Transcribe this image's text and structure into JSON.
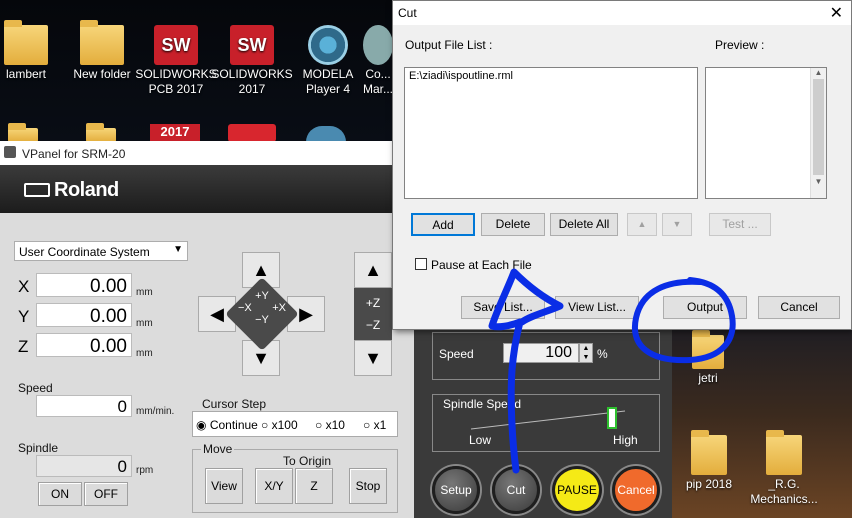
{
  "desktop": {
    "icons": [
      {
        "label": "lambert",
        "kind": "folder"
      },
      {
        "label": "New folder",
        "kind": "folder"
      },
      {
        "label": "SOLIDWORKS PCB 2017",
        "kind": "sw"
      },
      {
        "label": "SOLIDWORKS 2017",
        "kind": "sw2017"
      },
      {
        "label": "MODELA Player 4",
        "kind": "modela"
      },
      {
        "label": "Co... Mar...",
        "kind": "app"
      },
      {
        "label": "jetri",
        "kind": "folder"
      },
      {
        "label": "pip 2018",
        "kind": "folder"
      },
      {
        "label": "_R.G. Mechanics...",
        "kind": "folder"
      }
    ],
    "sw_badge": "SW",
    "sw_year": "2017"
  },
  "vpanel": {
    "title": "VPanel for SRM-20",
    "brand": "Roland",
    "coord_system": "User Coordinate System",
    "axes": [
      {
        "label": "X",
        "value": "0.00",
        "unit": "mm"
      },
      {
        "label": "Y",
        "value": "0.00",
        "unit": "mm"
      },
      {
        "label": "Z",
        "value": "0.00",
        "unit": "mm"
      }
    ],
    "speed": {
      "label": "Speed",
      "value": "0",
      "unit": "mm/min."
    },
    "spindle": {
      "label": "Spindle",
      "value": "0",
      "unit": "rpm",
      "on": "ON",
      "off": "OFF"
    },
    "jog": {
      "plus_y": "+Y",
      "minus_x": "−X",
      "plus_x": "+X",
      "minus_y": "−Y",
      "plus_z": "+Z",
      "minus_z": "−Z"
    },
    "cursor_step": {
      "label": "Cursor Step",
      "options": [
        "Continue",
        "x100",
        "x10",
        "x1"
      ],
      "selected": "Continue"
    },
    "move": {
      "label": "Move",
      "to_origin": "To Origin",
      "view": "View",
      "xy": "X/Y",
      "z": "Z",
      "stop": "Stop"
    }
  },
  "output_panel": {
    "speed_label": "Speed",
    "speed_value": "100",
    "speed_unit": "%",
    "spindle_speed_label": "Spindle Speed",
    "low": "Low",
    "high": "High",
    "setup": "Setup",
    "cut": "Cut",
    "pause": "PAUSE",
    "cancel": "Cancel",
    "pause_color": "#f5ea16",
    "cancel_color": "#f06a2c"
  },
  "cut_dialog": {
    "title": "Cut",
    "output_file_list_label": "Output File List :",
    "preview_label": "Preview :",
    "files": [
      "E:\\ziadi\\ispoutline.rml"
    ],
    "add": "Add",
    "delete": "Delete",
    "delete_all": "Delete All",
    "test": "Test ...",
    "pause_each": "Pause at Each File",
    "save_list": "Save List...",
    "view_list": "View List...",
    "output": "Output",
    "cancel": "Cancel"
  },
  "annotation_color": "#0a2de6"
}
